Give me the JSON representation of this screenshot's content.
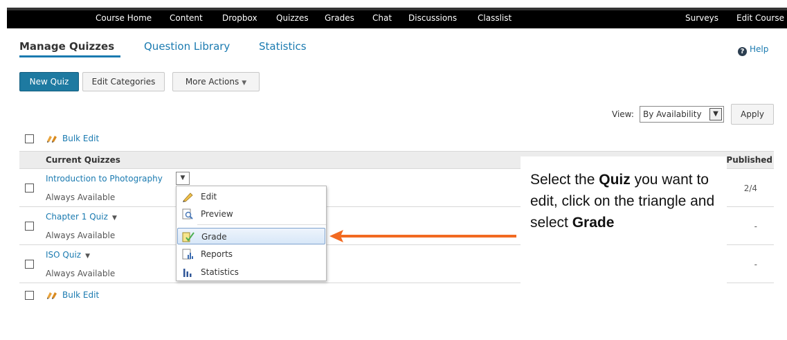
{
  "nav": {
    "items": [
      "Course Home",
      "Content",
      "Dropbox",
      "Quizzes",
      "Grades",
      "Chat",
      "Discussions",
      "Classlist",
      "Surveys",
      "Edit Course"
    ]
  },
  "tabs": {
    "manage": "Manage Quizzes",
    "library": "Question Library",
    "stats": "Statistics"
  },
  "help": "Help",
  "toolbar": {
    "new_quiz": "New Quiz",
    "edit_categories": "Edit Categories",
    "more_actions": "More Actions"
  },
  "view": {
    "label": "View:",
    "selected": "By Availability",
    "apply": "Apply"
  },
  "bulk_edit": "Bulk Edit",
  "table": {
    "header": "Current Quizzes",
    "published_header": "Published",
    "rows": [
      {
        "name": "Introduction to Photography",
        "availability": "Always Available",
        "published": "2/4"
      },
      {
        "name": "Chapter 1 Quiz",
        "availability": "Always Available",
        "published": "-"
      },
      {
        "name": "ISO Quiz",
        "availability": "Always Available",
        "published": "-"
      }
    ]
  },
  "context_menu": {
    "items": [
      "Edit",
      "Preview",
      "Grade",
      "Reports",
      "Statistics"
    ],
    "highlighted": "Grade"
  },
  "callout": {
    "line1_pre": "Select the ",
    "line1_bold": "Quiz",
    "line1_post": " you want to edit, click on the triangle and select ",
    "line2_bold": "Grade"
  },
  "colors": {
    "link": "#1a7ab0",
    "primary_button": "#1e7aa1",
    "arrow": "#f26a21",
    "navbar": "#000000"
  }
}
